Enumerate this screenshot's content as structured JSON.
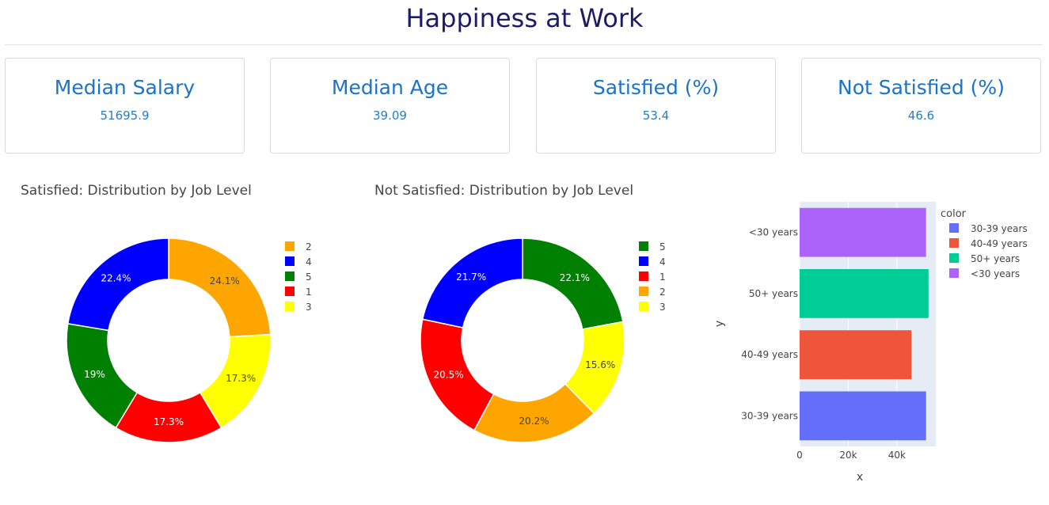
{
  "page": {
    "title": "Happiness at Work"
  },
  "kpis": [
    {
      "title": "Median Salary",
      "value": "51695.9"
    },
    {
      "title": "Median Age",
      "value": "39.09"
    },
    {
      "title": "Satisfied (%)",
      "value": "53.4"
    },
    {
      "title": "Not Satisfied (%)",
      "value": "46.6"
    }
  ],
  "chart_data": [
    {
      "type": "pie",
      "title": "Satisfied: Distribution by Job Level",
      "hole": true,
      "labels": [
        "2",
        "3",
        "1",
        "5",
        "4"
      ],
      "values": [
        24.1,
        17.3,
        17.3,
        19,
        22.4
      ],
      "value_labels": [
        "24.1%",
        "17.3%",
        "17.3%",
        "19%",
        "22.4%"
      ],
      "colors": [
        "#ffa500",
        "#ffff00",
        "#ff0000",
        "#008000",
        "#0000ff"
      ],
      "legend": [
        "2",
        "4",
        "5",
        "1",
        "3"
      ],
      "legend_position": "right"
    },
    {
      "type": "pie",
      "title": "Not Satisfied: Distribution by Job Level",
      "hole": true,
      "labels": [
        "5",
        "3",
        "2",
        "1",
        "4"
      ],
      "values": [
        22.1,
        15.6,
        20.2,
        20.5,
        21.7
      ],
      "value_labels": [
        "22.1%",
        "15.6%",
        "20.2%",
        "20.5%",
        "21.7%"
      ],
      "colors": [
        "#008000",
        "#ffff00",
        "#ffa500",
        "#ff0000",
        "#0000ff"
      ],
      "legend": [
        "5",
        "4",
        "1",
        "2",
        "3"
      ],
      "legend_position": "right"
    },
    {
      "type": "bar",
      "orientation": "horizontal",
      "categories": [
        "30-39 years",
        "40-49 years",
        "50+ years",
        "<30 years"
      ],
      "values": [
        52000,
        46000,
        53000,
        52000
      ],
      "colors": [
        "#636efa",
        "#ef553b",
        "#00cc96",
        "#ab63fa"
      ],
      "xlabel": "x",
      "ylabel": "y",
      "xlim": [
        0,
        56000
      ],
      "xticks": [
        0,
        20000,
        40000
      ],
      "xtick_labels": [
        "0",
        "20k",
        "40k"
      ],
      "legend_title": "color",
      "legend": [
        "30-39 years",
        "40-49 years",
        "50+ years",
        "<30 years"
      ],
      "legend_position": "right",
      "plot_background": "#e5ecf6"
    }
  ],
  "legend_colors": {
    "job_levels": {
      "1": "#ff0000",
      "2": "#ffa500",
      "3": "#ffff00",
      "4": "#0000ff",
      "5": "#008000"
    }
  }
}
